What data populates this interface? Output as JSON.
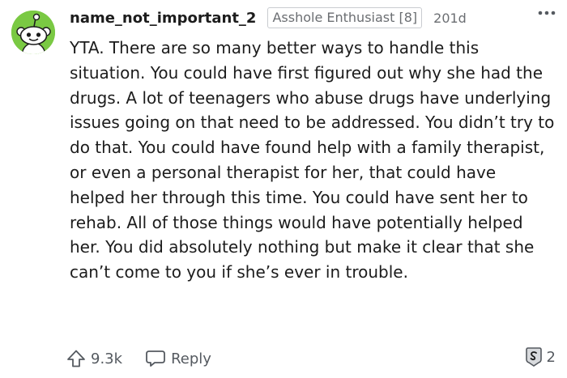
{
  "comment": {
    "username": "name_not_important_2",
    "flair": "Asshole Enthusiast [8]",
    "age": "201d",
    "body": "YTA. There are so many better ways to handle this situation. You could have first figured out why she had the drugs. A lot of teenagers who abuse drugs have underlying issues going on that need to be addressed. You didn’t try to do that. You could have found help with a family therapist, or even a personal therapist for her, that could have helped her through this time. You could have sent her to rehab. All of those things would have potentially helped her. You did absolutely nothing but make it clear that she can’t come to you if she’s ever in trouble.",
    "upvotes": "9.3k",
    "reply_label": "Reply",
    "award_count": "2"
  },
  "icons": {
    "avatar": "snoo-avatar",
    "more": "more-options-icon",
    "upvote": "upvote-arrow-icon",
    "reply": "speech-bubble-icon",
    "award": "award-icon"
  },
  "colors": {
    "avatar_bg": "#7ac943",
    "text": "#1c1c1c",
    "muted": "#6b6e72"
  }
}
